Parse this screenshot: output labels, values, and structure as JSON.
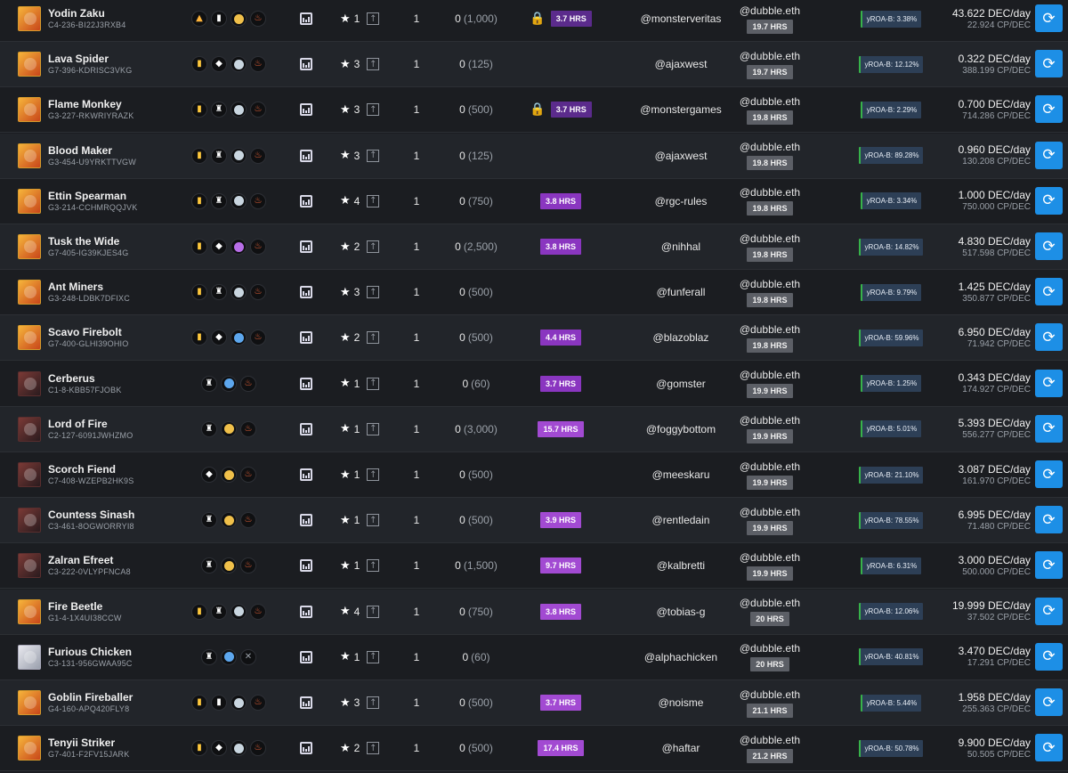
{
  "rows": [
    {
      "name": "Yodin Zaku",
      "id": "C4-236-BI22J3RXB4",
      "icons": [
        "flame",
        "shield",
        "coin-yellow",
        "fire"
      ],
      "stars": "1",
      "qty": "1",
      "xp": "0",
      "xp_cap": "(1,000)",
      "locked": true,
      "hrs": "3.7 HRS",
      "owner": "@monsterveritas",
      "renter": "@dubble.eth",
      "renter_hrs": "19.7 HRS",
      "roa": "yROA-B: 3.38%",
      "dec": "43.622 DEC/day",
      "cp": "22.924 CP/DEC",
      "thumb": "gold"
    },
    {
      "name": "Lava Spider",
      "id": "G7-396-KDRISC3VKG",
      "icons": [
        "card",
        "diamond",
        "coin-lightblue",
        "fire"
      ],
      "stars": "3",
      "qty": "1",
      "xp": "0",
      "xp_cap": "(125)",
      "locked": false,
      "hrs": "",
      "owner": "@ajaxwest",
      "renter": "@dubble.eth",
      "renter_hrs": "19.7 HRS",
      "roa": "yROA-B: 12.12%",
      "dec": "0.322 DEC/day",
      "cp": "388.199 CP/DEC",
      "thumb": "gold"
    },
    {
      "name": "Flame Monkey",
      "id": "G3-227-RKWRIYRAZK",
      "icons": [
        "card",
        "pawn",
        "coin-lightblue",
        "fire"
      ],
      "stars": "3",
      "qty": "1",
      "xp": "0",
      "xp_cap": "(500)",
      "locked": true,
      "hrs": "3.7 HRS",
      "owner": "@monstergames",
      "renter": "@dubble.eth",
      "renter_hrs": "19.8 HRS",
      "roa": "yROA-B: 2.29%",
      "dec": "0.700 DEC/day",
      "cp": "714.286 CP/DEC",
      "thumb": "gold"
    },
    {
      "name": "Blood Maker",
      "id": "G3-454-U9YRKTTVGW",
      "icons": [
        "card",
        "pawn",
        "coin-lightblue",
        "fire"
      ],
      "stars": "3",
      "qty": "1",
      "xp": "0",
      "xp_cap": "(125)",
      "locked": false,
      "hrs": "",
      "owner": "@ajaxwest",
      "renter": "@dubble.eth",
      "renter_hrs": "19.8 HRS",
      "roa": "yROA-B: 89.28%",
      "dec": "0.960 DEC/day",
      "cp": "130.208 CP/DEC",
      "thumb": "gold"
    },
    {
      "name": "Ettin Spearman",
      "id": "G3-214-CCHMRQQJVK",
      "icons": [
        "card",
        "pawn",
        "coin-lightblue",
        "fire"
      ],
      "stars": "4",
      "qty": "1",
      "xp": "0",
      "xp_cap": "(750)",
      "locked": false,
      "hrs": "3.8 HRS",
      "owner": "@rgc-rules",
      "renter": "@dubble.eth",
      "renter_hrs": "19.8 HRS",
      "roa": "yROA-B: 3.34%",
      "dec": "1.000 DEC/day",
      "cp": "750.000 CP/DEC",
      "thumb": "gold"
    },
    {
      "name": "Tusk the Wide",
      "id": "G7-405-IG39KJES4G",
      "icons": [
        "card",
        "diamond",
        "coin-purple",
        "fire"
      ],
      "stars": "2",
      "qty": "1",
      "xp": "0",
      "xp_cap": "(2,500)",
      "locked": false,
      "hrs": "3.8 HRS",
      "owner": "@nihhal",
      "renter": "@dubble.eth",
      "renter_hrs": "19.8 HRS",
      "roa": "yROA-B: 14.82%",
      "dec": "4.830 DEC/day",
      "cp": "517.598 CP/DEC",
      "thumb": "gold"
    },
    {
      "name": "Ant Miners",
      "id": "G3-248-LDBK7DFIXC",
      "icons": [
        "card",
        "pawn",
        "coin-lightblue",
        "fire"
      ],
      "stars": "3",
      "qty": "1",
      "xp": "0",
      "xp_cap": "(500)",
      "locked": false,
      "hrs": "",
      "owner": "@funferall",
      "renter": "@dubble.eth",
      "renter_hrs": "19.8 HRS",
      "roa": "yROA-B: 9.79%",
      "dec": "1.425 DEC/day",
      "cp": "350.877 CP/DEC",
      "thumb": "gold"
    },
    {
      "name": "Scavo Firebolt",
      "id": "G7-400-GLHI39OHIO",
      "icons": [
        "card",
        "diamond",
        "coin-blue",
        "fire"
      ],
      "stars": "2",
      "qty": "1",
      "xp": "0",
      "xp_cap": "(500)",
      "locked": false,
      "hrs": "4.4 HRS",
      "owner": "@blazoblaz",
      "renter": "@dubble.eth",
      "renter_hrs": "19.8 HRS",
      "roa": "yROA-B: 59.96%",
      "dec": "6.950 DEC/day",
      "cp": "71.942 CP/DEC",
      "thumb": "gold"
    },
    {
      "name": "Cerberus",
      "id": "C1-8-KBB57FJOBK",
      "icons": [
        "pawn",
        "coin-blue",
        "fire"
      ],
      "stars": "1",
      "qty": "1",
      "xp": "0",
      "xp_cap": "(60)",
      "locked": false,
      "hrs": "3.7 HRS",
      "owner": "@gomster",
      "renter": "@dubble.eth",
      "renter_hrs": "19.9 HRS",
      "roa": "yROA-B: 1.25%",
      "dec": "0.343 DEC/day",
      "cp": "174.927 CP/DEC",
      "thumb": "dark"
    },
    {
      "name": "Lord of Fire",
      "id": "C2-127-6091JWHZMO",
      "icons": [
        "pawn",
        "coin-yellow",
        "fire"
      ],
      "stars": "1",
      "qty": "1",
      "xp": "0",
      "xp_cap": "(3,000)",
      "locked": false,
      "hrs": "15.7 HRS",
      "owner": "@foggybottom",
      "renter": "@dubble.eth",
      "renter_hrs": "19.9 HRS",
      "roa": "yROA-B: 5.01%",
      "dec": "5.393 DEC/day",
      "cp": "556.277 CP/DEC",
      "thumb": "dark"
    },
    {
      "name": "Scorch Fiend",
      "id": "C7-408-WZEPB2HK9S",
      "icons": [
        "diamond",
        "coin-yellow",
        "fire"
      ],
      "stars": "1",
      "qty": "1",
      "xp": "0",
      "xp_cap": "(500)",
      "locked": false,
      "hrs": "",
      "owner": "@meeskaru",
      "renter": "@dubble.eth",
      "renter_hrs": "19.9 HRS",
      "roa": "yROA-B: 21.10%",
      "dec": "3.087 DEC/day",
      "cp": "161.970 CP/DEC",
      "thumb": "dark"
    },
    {
      "name": "Countess Sinash",
      "id": "C3-461-8OGWORRYI8",
      "icons": [
        "pawn",
        "coin-yellow",
        "fire"
      ],
      "stars": "1",
      "qty": "1",
      "xp": "0",
      "xp_cap": "(500)",
      "locked": false,
      "hrs": "3.9 HRS",
      "owner": "@rentledain",
      "renter": "@dubble.eth",
      "renter_hrs": "19.9 HRS",
      "roa": "yROA-B: 78.55%",
      "dec": "6.995 DEC/day",
      "cp": "71.480 CP/DEC",
      "thumb": "dark"
    },
    {
      "name": "Zalran Efreet",
      "id": "C3-222-0VLYPFNCA8",
      "icons": [
        "pawn",
        "coin-yellow",
        "fire"
      ],
      "stars": "1",
      "qty": "1",
      "xp": "0",
      "xp_cap": "(1,500)",
      "locked": false,
      "hrs": "9.7 HRS",
      "owner": "@kalbretti",
      "renter": "@dubble.eth",
      "renter_hrs": "19.9 HRS",
      "roa": "yROA-B: 6.31%",
      "dec": "3.000 DEC/day",
      "cp": "500.000 CP/DEC",
      "thumb": "dark"
    },
    {
      "name": "Fire Beetle",
      "id": "G1-4-1X4UI38CCW",
      "icons": [
        "card",
        "pawn",
        "coin-lightblue",
        "fire"
      ],
      "stars": "4",
      "qty": "1",
      "xp": "0",
      "xp_cap": "(750)",
      "locked": false,
      "hrs": "3.8 HRS",
      "owner": "@tobias-g",
      "renter": "@dubble.eth",
      "renter_hrs": "20 HRS",
      "roa": "yROA-B: 12.06%",
      "dec": "19.999 DEC/day",
      "cp": "37.502 CP/DEC",
      "thumb": "gold"
    },
    {
      "name": "Furious Chicken",
      "id": "C3-131-956GWAA95C",
      "icons": [
        "pawn",
        "coin-blue",
        "neutral"
      ],
      "stars": "1",
      "qty": "1",
      "xp": "0",
      "xp_cap": "(60)",
      "locked": false,
      "hrs": "",
      "owner": "@alphachicken",
      "renter": "@dubble.eth",
      "renter_hrs": "20 HRS",
      "roa": "yROA-B: 40.81%",
      "dec": "3.470 DEC/day",
      "cp": "17.291 CP/DEC",
      "thumb": "white"
    },
    {
      "name": "Goblin Fireballer",
      "id": "G4-160-APQ420FLY8",
      "icons": [
        "card",
        "shield",
        "coin-lightblue",
        "fire"
      ],
      "stars": "3",
      "qty": "1",
      "xp": "0",
      "xp_cap": "(500)",
      "locked": false,
      "hrs": "3.7 HRS",
      "owner": "@noisme",
      "renter": "@dubble.eth",
      "renter_hrs": "21.1 HRS",
      "roa": "yROA-B: 5.44%",
      "dec": "1.958 DEC/day",
      "cp": "255.363 CP/DEC",
      "thumb": "gold"
    },
    {
      "name": "Tenyii Striker",
      "id": "G7-401-F2FV15JARK",
      "icons": [
        "card",
        "diamond",
        "coin-lightblue",
        "fire"
      ],
      "stars": "2",
      "qty": "1",
      "xp": "0",
      "xp_cap": "(500)",
      "locked": false,
      "hrs": "17.4 HRS",
      "owner": "@haftar",
      "renter": "@dubble.eth",
      "renter_hrs": "21.2 HRS",
      "roa": "yROA-B: 50.78%",
      "dec": "9.900 DEC/day",
      "cp": "50.505 CP/DEC",
      "thumb": "gold"
    }
  ],
  "icons": {
    "star": "★",
    "upgrade": "↑",
    "lock": "🔒",
    "refresh": "⟳",
    "glyphs": {
      "flame": "▲",
      "shield": "▮",
      "card": "▮",
      "diamond": "◆",
      "pawn": "♜",
      "fire": "♨",
      "neutral": "✕"
    }
  }
}
